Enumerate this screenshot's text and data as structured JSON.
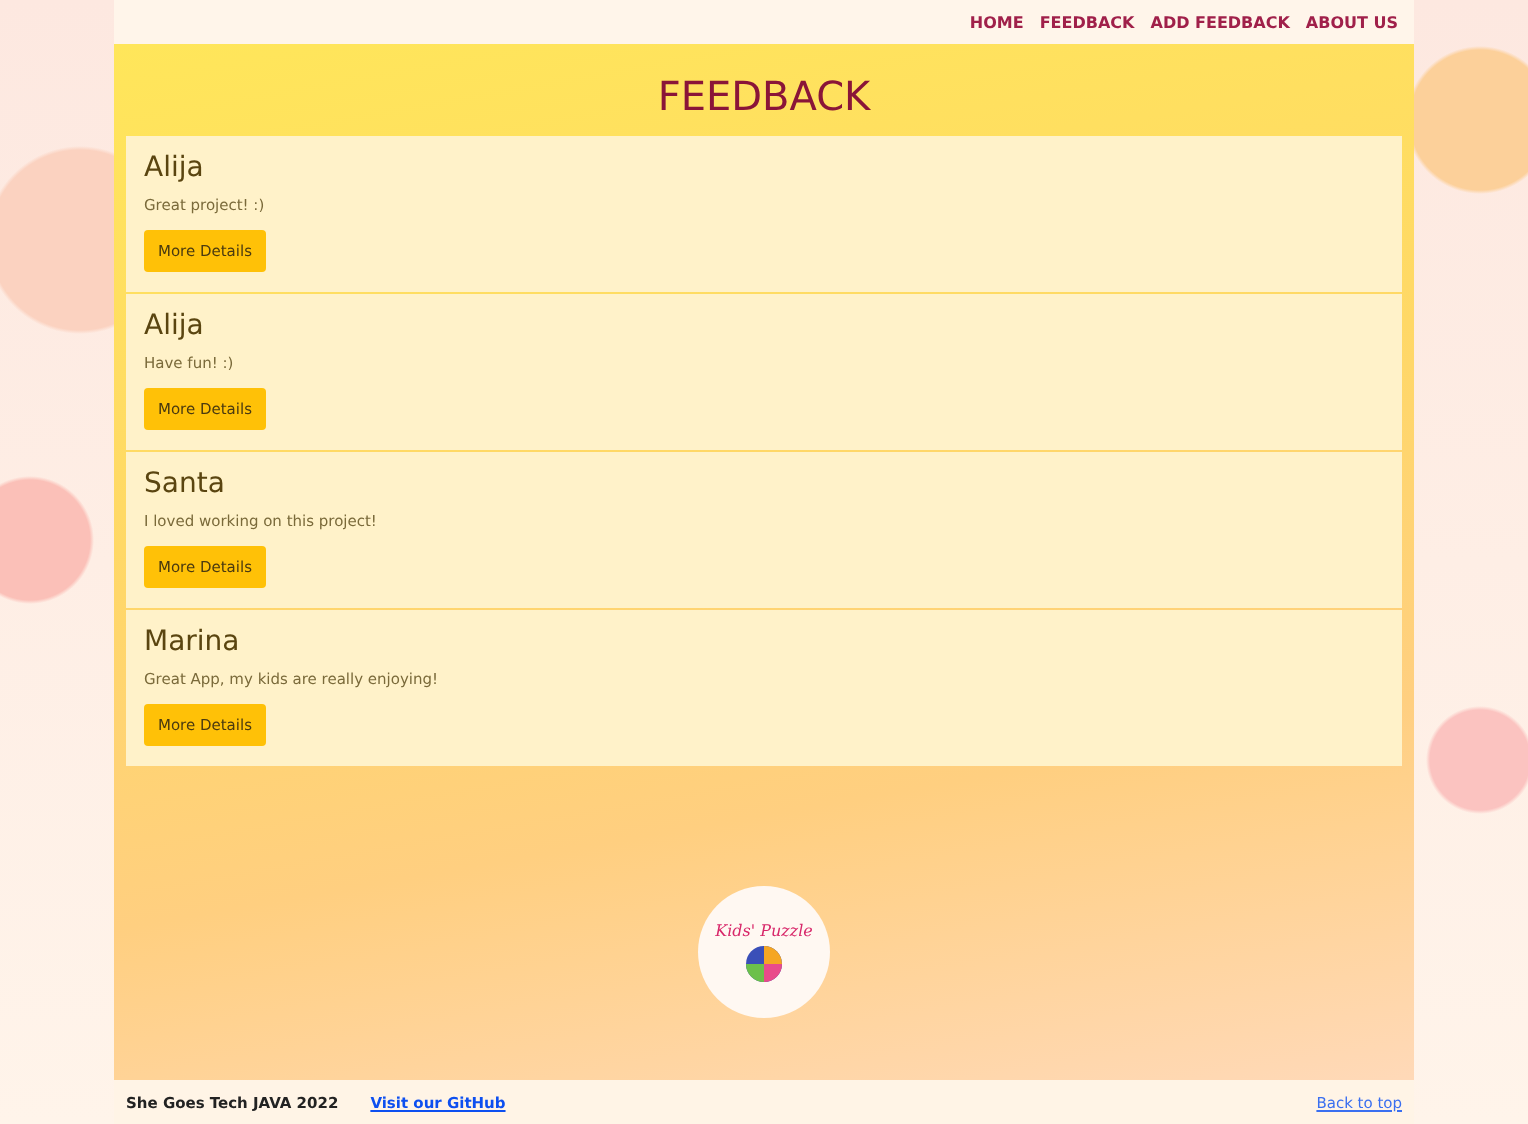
{
  "nav": {
    "links": [
      {
        "label": "HOME"
      },
      {
        "label": "FEEDBACK"
      },
      {
        "label": "ADD FEEDBACK"
      },
      {
        "label": "ABOUT US"
      }
    ]
  },
  "page_title": "FEEDBACK",
  "feedback": [
    {
      "name": "Alija",
      "message": "Great project! :)",
      "button": "More Details"
    },
    {
      "name": "Alija",
      "message": "Have fun! :)",
      "button": "More Details"
    },
    {
      "name": "Santa",
      "message": "I loved working on this project!",
      "button": "More Details"
    },
    {
      "name": "Marina",
      "message": "Great App, my kids are really enjoying!",
      "button": "More Details"
    }
  ],
  "logo": {
    "text": "Kids' Puzzle"
  },
  "footer": {
    "text": "She Goes Tech JAVA 2022",
    "github_link": "Visit our GitHub",
    "back_to_top": "Back to top"
  }
}
